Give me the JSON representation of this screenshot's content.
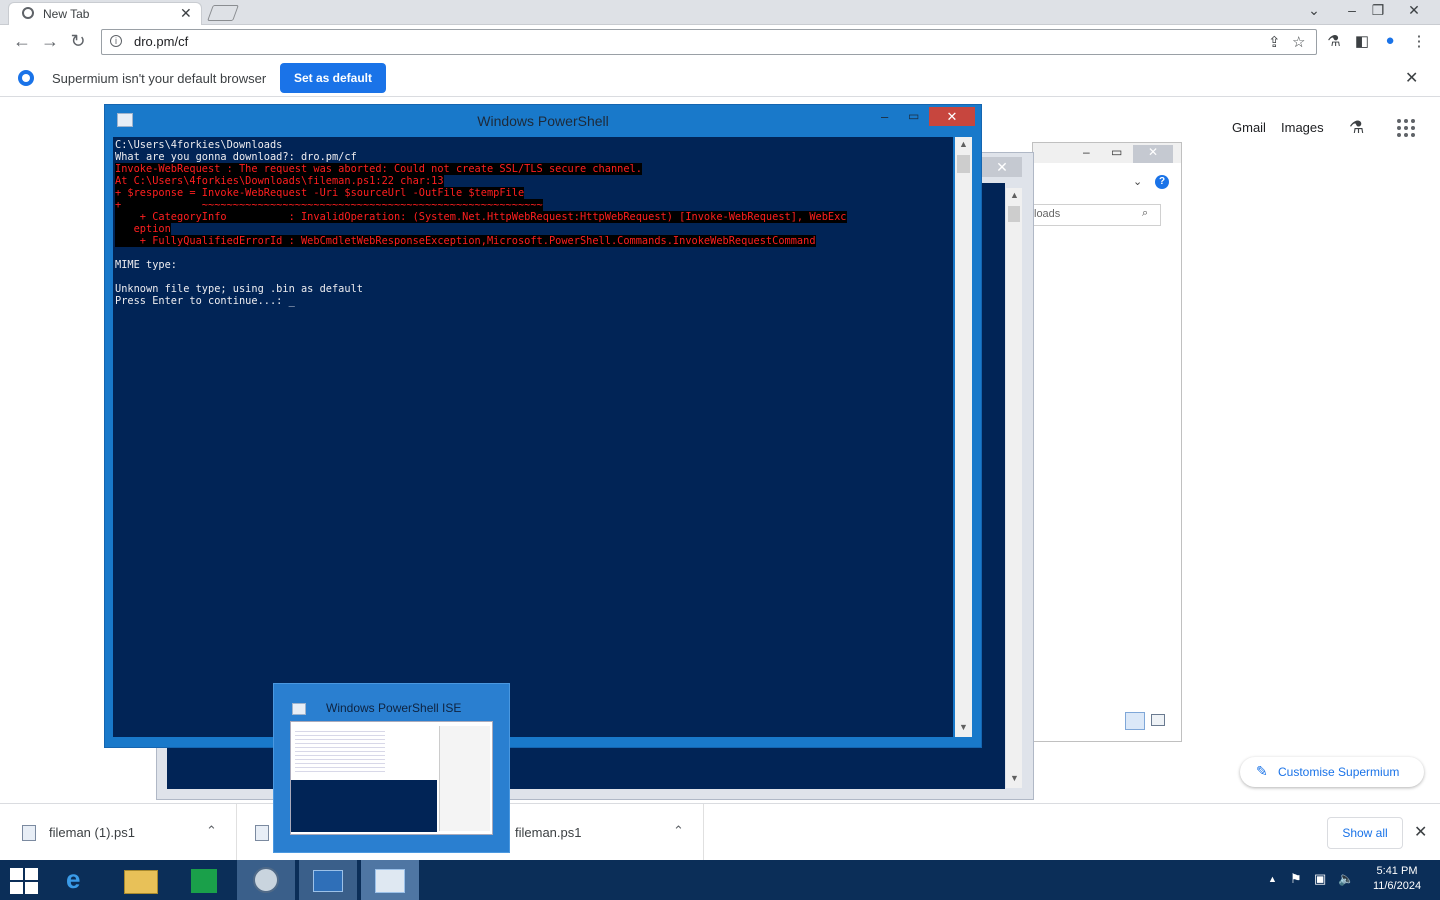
{
  "browser": {
    "tab": {
      "title": "New Tab"
    },
    "url": "dro.pm/cf",
    "infobar": {
      "message": "Supermium isn't your default browser",
      "button": "Set as default"
    },
    "ntp": {
      "gmail": "Gmail",
      "images": "Images",
      "customise": "Customise Supermium"
    }
  },
  "powershell": {
    "title": "Windows PowerShell",
    "lines": [
      {
        "text": "C:\\Users\\4forkies\\Downloads",
        "type": "normal"
      },
      {
        "text": "What are you gonna download?: dro.pm/cf",
        "type": "normal"
      },
      {
        "text": "Invoke-WebRequest : The request was aborted: Could not create SSL/TLS secure channel.",
        "type": "error"
      },
      {
        "text": "At C:\\Users\\4forkies\\Downloads\\fileman.ps1:22 char:13",
        "type": "error"
      },
      {
        "text": "+ $response = Invoke-WebRequest -Uri $sourceUrl -OutFile $tempFile",
        "type": "error"
      },
      {
        "text": "+             ~~~~~~~~~~~~~~~~~~~~~~~~~~~~~~~~~~~~~~~~~~~~~~~~~~~~~~~",
        "type": "error"
      },
      {
        "text": "    + CategoryInfo          : InvalidOperation: (System.Net.HttpWebRequest:HttpWebRequest) [Invoke-WebRequest], WebExc",
        "type": "error"
      },
      {
        "text": "   eption",
        "type": "error"
      },
      {
        "text": "    + FullyQualifiedErrorId : WebCmdletWebResponseException,Microsoft.PowerShell.Commands.InvokeWebRequestCommand",
        "type": "error"
      },
      {
        "text": "",
        "type": "normal"
      },
      {
        "text": "MIME type:",
        "type": "normal"
      },
      {
        "text": "",
        "type": "normal"
      },
      {
        "text": "Unknown file type; using .bin as default",
        "type": "normal"
      },
      {
        "text": "Press Enter to continue...: _",
        "type": "normal"
      }
    ]
  },
  "explorer": {
    "search_placeholder": "loads"
  },
  "preview": {
    "title": "Windows PowerShell ISE"
  },
  "downloads": {
    "items": [
      {
        "name": "fileman (1).ps1"
      },
      {
        "name": "fileman.ps1"
      }
    ],
    "show_all": "Show all"
  },
  "taskbar": {
    "time": "5:41 PM",
    "date": "11/6/2024"
  },
  "icons": {
    "back": "arrow-left-icon",
    "forward": "arrow-right-icon",
    "reload": "reload-icon",
    "share": "share-icon",
    "star": "star-icon",
    "labs": "flask-icon",
    "sidepanel": "side-panel-icon",
    "profile": "profile-icon",
    "menu": "kebab-menu-icon",
    "apps": "apps-grid-icon"
  },
  "colors": {
    "ps_background": "#012456",
    "ps_error": "#ff1f1f",
    "accent": "#1a73e8",
    "taskbar": "#0b2e58"
  }
}
